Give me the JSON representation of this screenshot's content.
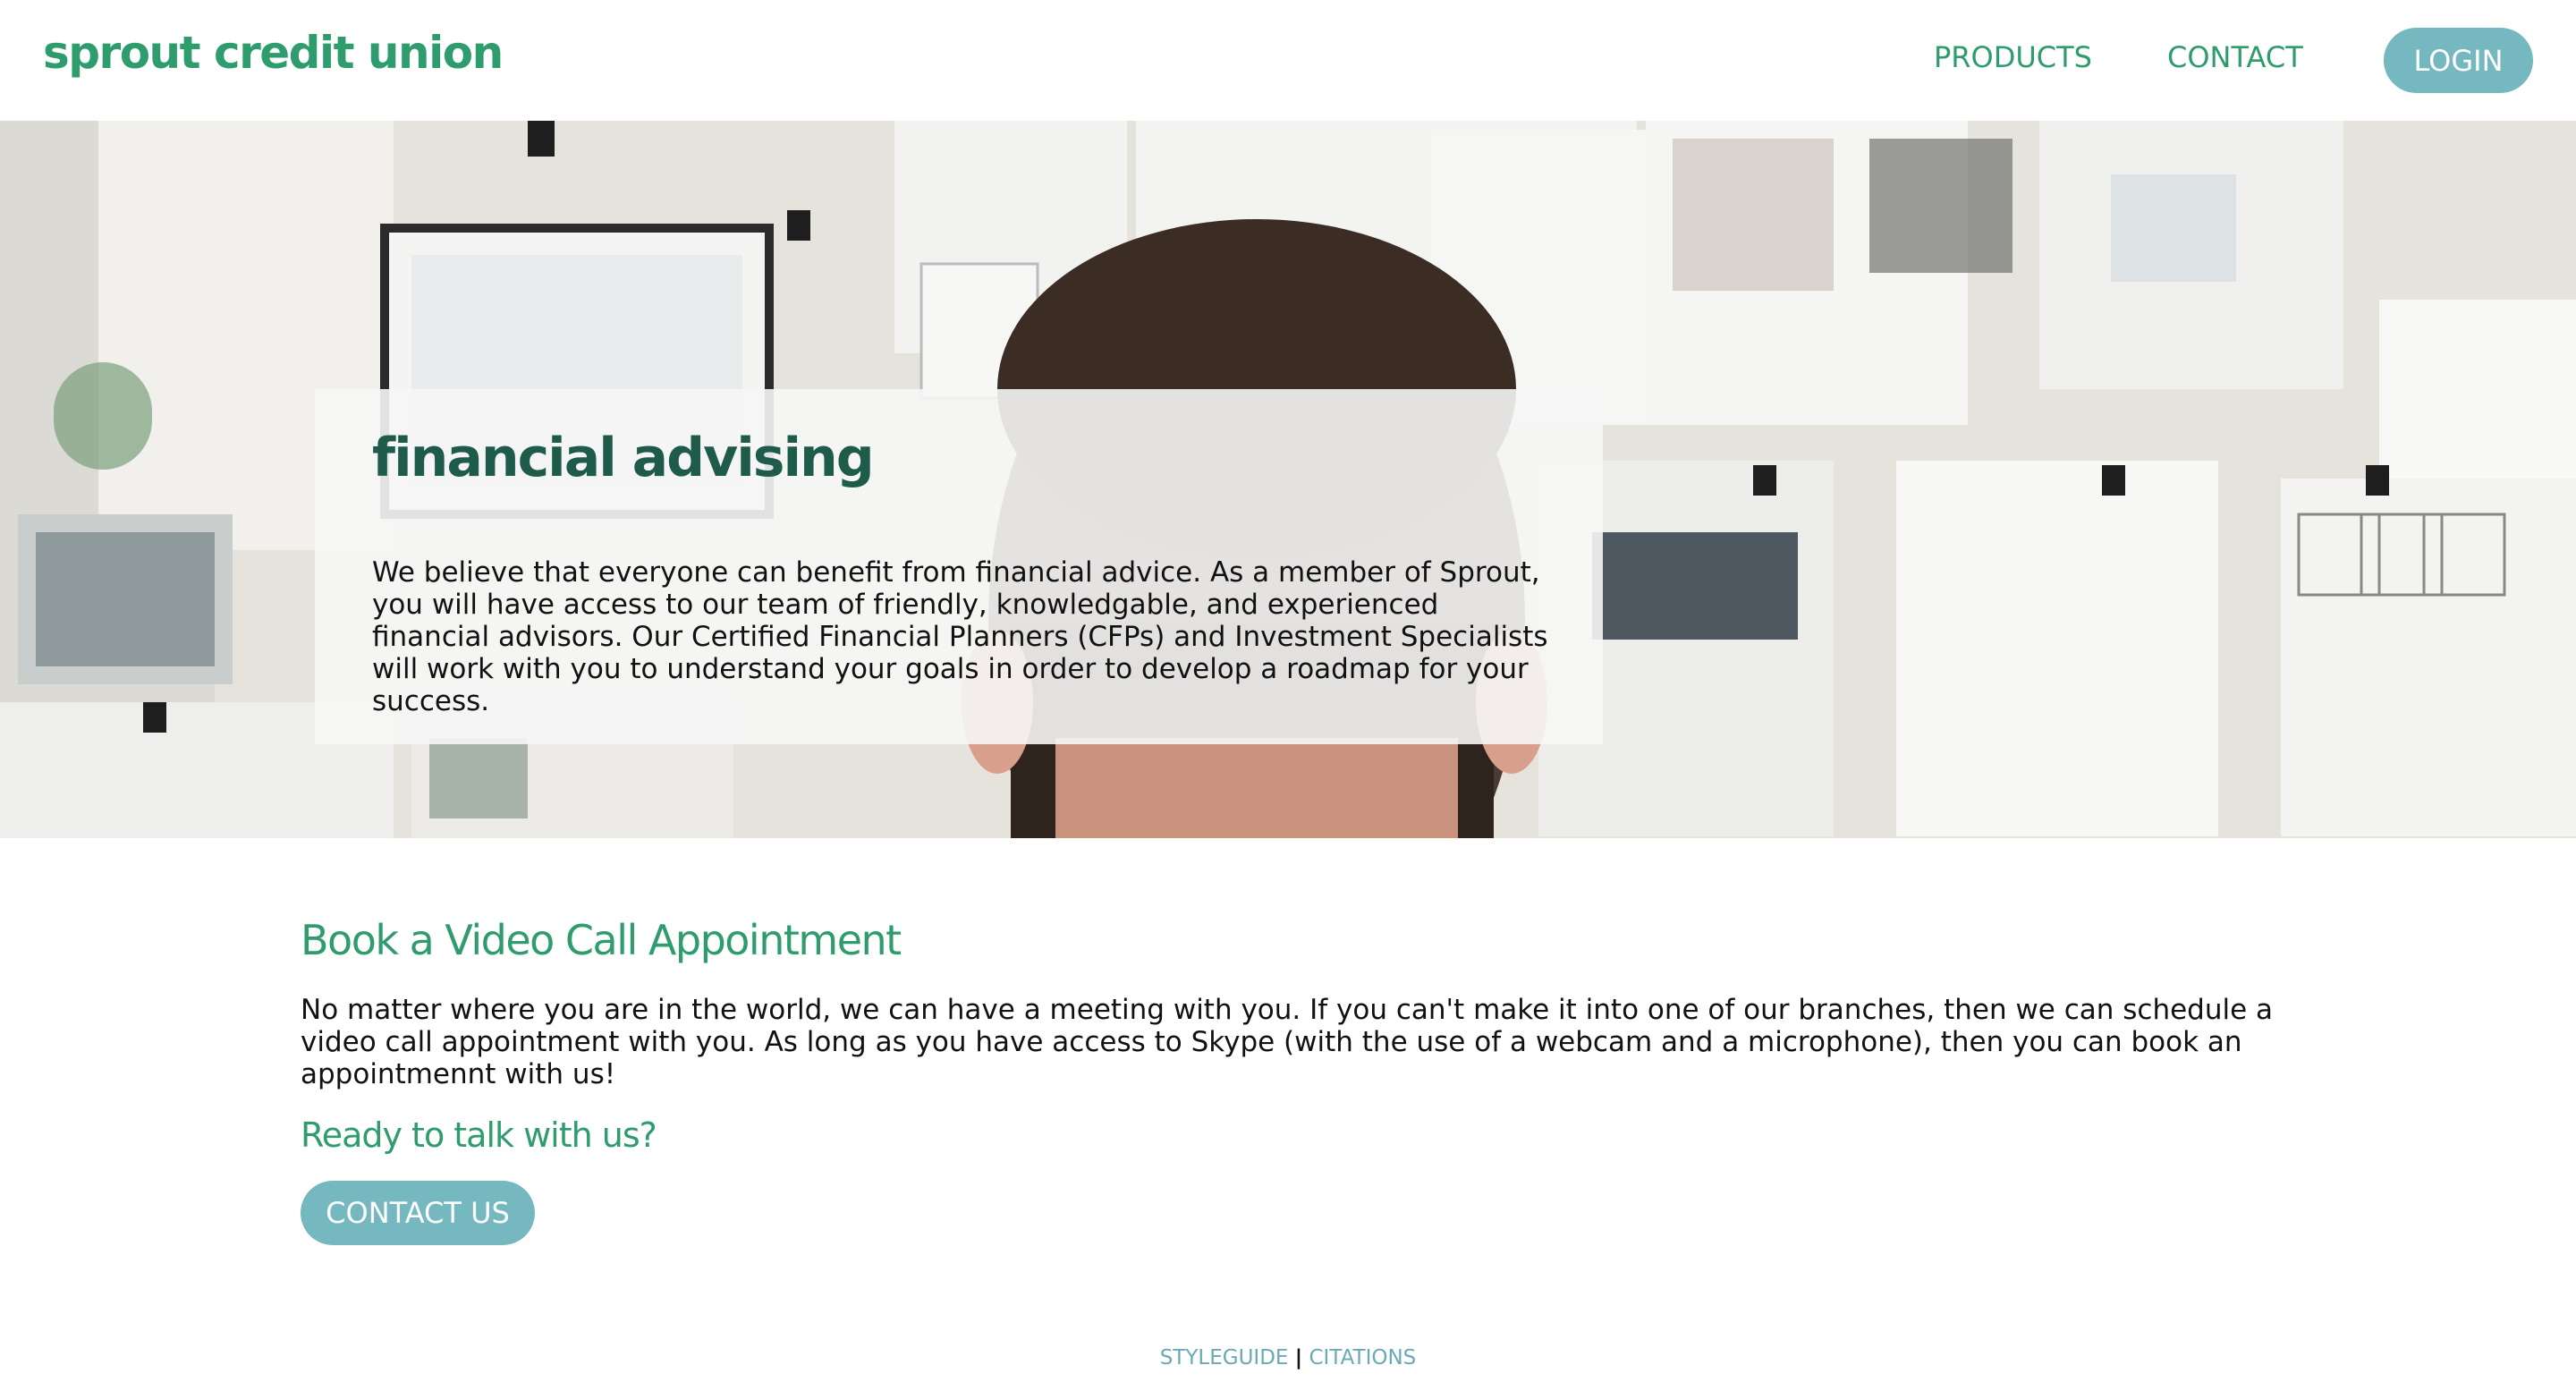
{
  "header": {
    "logo": "sprout credit union",
    "nav": {
      "products": "PRODUCTS",
      "contact": "CONTACT"
    },
    "login": "LOGIN"
  },
  "hero": {
    "title": "financial advising",
    "text": "We believe that everyone can benefit from financial advice. As a member of Sprout, you will have access to our team of friendly, knowledgable, and experienced financial advisors. Our Certified Financial Planners (CFPs) and Investment Specialists will work with you to understand your goals in order to develop a roadmap for your success."
  },
  "main": {
    "heading": "Book a Video Call Appointment",
    "text": "No matter where you are in the world, we can have a meeting with you. If you can't make it into one of our branches, then we can schedule a video call appointment with you. As long as you have access to Skype (with the use of a webcam and a microphone), then you can book an appointmennt with us!",
    "ready": "Ready to talk with us?",
    "contact_button": "CONTACT US"
  },
  "footer": {
    "styleguide": "STYLEGUIDE",
    "separator": "|",
    "citations": "CITATIONS"
  },
  "colors": {
    "brand_green": "#2f9c6e",
    "dark_green": "#1f5b4a",
    "button_teal": "#76b8bf",
    "footer_link": "#6aaab5"
  }
}
